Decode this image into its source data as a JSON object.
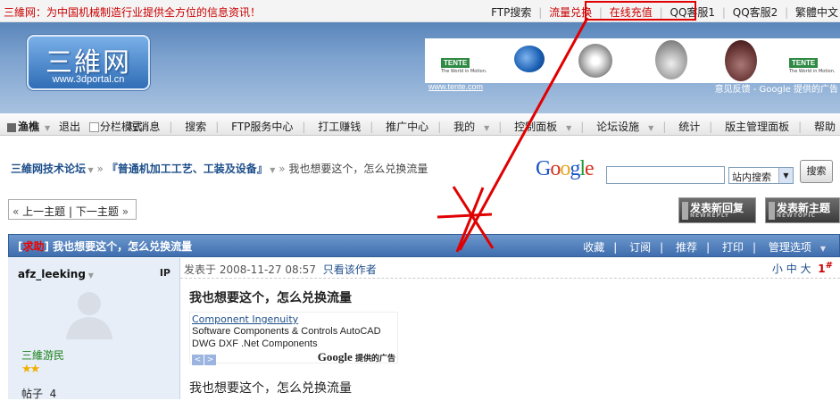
{
  "topbar": {
    "welcome": "三維网：为中国机械制造行业提供全方位的信息资讯！",
    "links": [
      "FTP搜索",
      "流量兑换",
      "在线充值",
      "QQ客服1",
      "QQ客服2",
      "繁體中文"
    ]
  },
  "header": {
    "logo_cn": "三維网",
    "logo_url": "www.3dportal.cn",
    "banner_brand": "TENTE",
    "banner_slogan": "The World in Motion.",
    "banner_link": "www.tente.com",
    "ad_feedback": "意见反馈 - Google 提供的广告"
  },
  "nav": {
    "user": "渔樵",
    "logout": "退出",
    "mode": "分栏模式",
    "items": [
      "短消息",
      "搜索",
      "FTP服务中心",
      "打工赚钱",
      "推广中心",
      "我的",
      "控制面板",
      "论坛设施",
      "统计",
      "版主管理面板",
      "帮助"
    ]
  },
  "breadcrumb": {
    "forum": "三維网技术论坛",
    "board": "『普通机加工工艺、工装及设备』",
    "current": "我也想要这个，怎么兑换流量"
  },
  "search": {
    "google": "Google",
    "scope": "站内搜索",
    "button": "搜索",
    "value": ""
  },
  "pager": {
    "prev": "上一主题",
    "next": "下一主题"
  },
  "buttons": {
    "reply": "发表新回复",
    "reply_en": "NEWREPLY",
    "topic": "发表新主题",
    "topic_en": "NEWTOPIC"
  },
  "thread": {
    "tag": "求助",
    "title": "我也想要这个，怎么兑换流量",
    "actions": [
      "收藏",
      "订阅",
      "推荐",
      "打印",
      "管理选项"
    ]
  },
  "post": {
    "author": "afz_leeking",
    "ip": "IP",
    "rank": "三維游民",
    "stat_label": "帖子",
    "stat_value": "4",
    "posted": "发表于 2008-11-27 08:57",
    "author_only": "只看该作者",
    "font_sizes": [
      "小",
      "中",
      "大"
    ],
    "floor": "1",
    "floor_mark": "#",
    "title": "我也想要这个，怎么兑换流量",
    "ad_line1": "Component Ingenuity",
    "ad_line2": "Software Components & Controls AutoCAD",
    "ad_line3": "DWG DXF .Net Components",
    "ad_google": "Google",
    "ad_provided": "提供的广告",
    "body": "我也想要这个，怎么兑换流量"
  },
  "colors": {
    "accent_red": "#e00000",
    "header_blue": "#5a86bb",
    "link_blue": "#1d4e8a"
  }
}
